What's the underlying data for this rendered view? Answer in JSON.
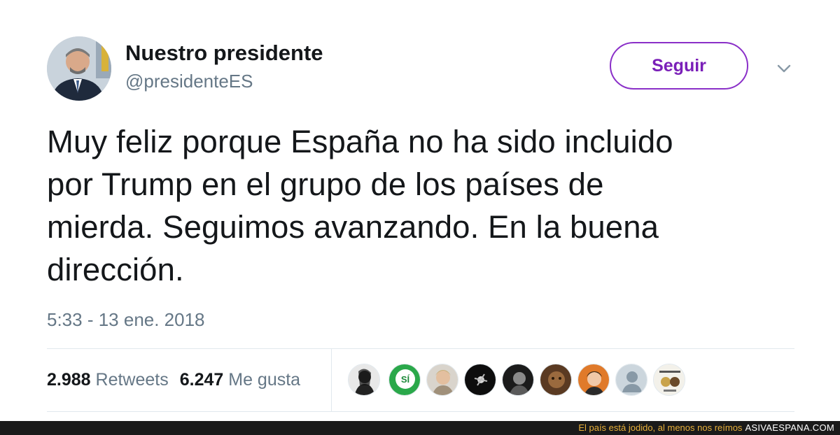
{
  "tweet": {
    "display_name": "Nuestro presidente",
    "handle": "@presidenteES",
    "follow_label": "Seguir",
    "text_lines": [
      "Muy feliz porque España no ha sido incluido",
      "por Trump en el grupo de los países de",
      "mierda. Seguimos avanzando. En la buena",
      "dirección."
    ],
    "timestamp": "5:33 - 13 ene. 2018",
    "retweets_count": "2.988",
    "retweets_label": "Retweets",
    "likes_count": "6.247",
    "likes_label": "Me gusta",
    "liker_avatars": [
      "avatar-1",
      "avatar-2-si",
      "avatar-3",
      "avatar-4",
      "avatar-5",
      "avatar-6",
      "avatar-7",
      "avatar-default",
      "avatar-9"
    ],
    "liker_badge_text": "SÍ"
  },
  "footer": {
    "slogan": "El país está jodido, al menos nos reímos",
    "brand": "ASIVAESPANA.COM"
  },
  "colors": {
    "accent": "#7a1fb8",
    "muted": "#657786",
    "text": "#14171a",
    "footer_bg": "#1a1a1a",
    "slogan": "#e8b03a"
  },
  "icons": {
    "caret": "chevron-down-icon"
  }
}
